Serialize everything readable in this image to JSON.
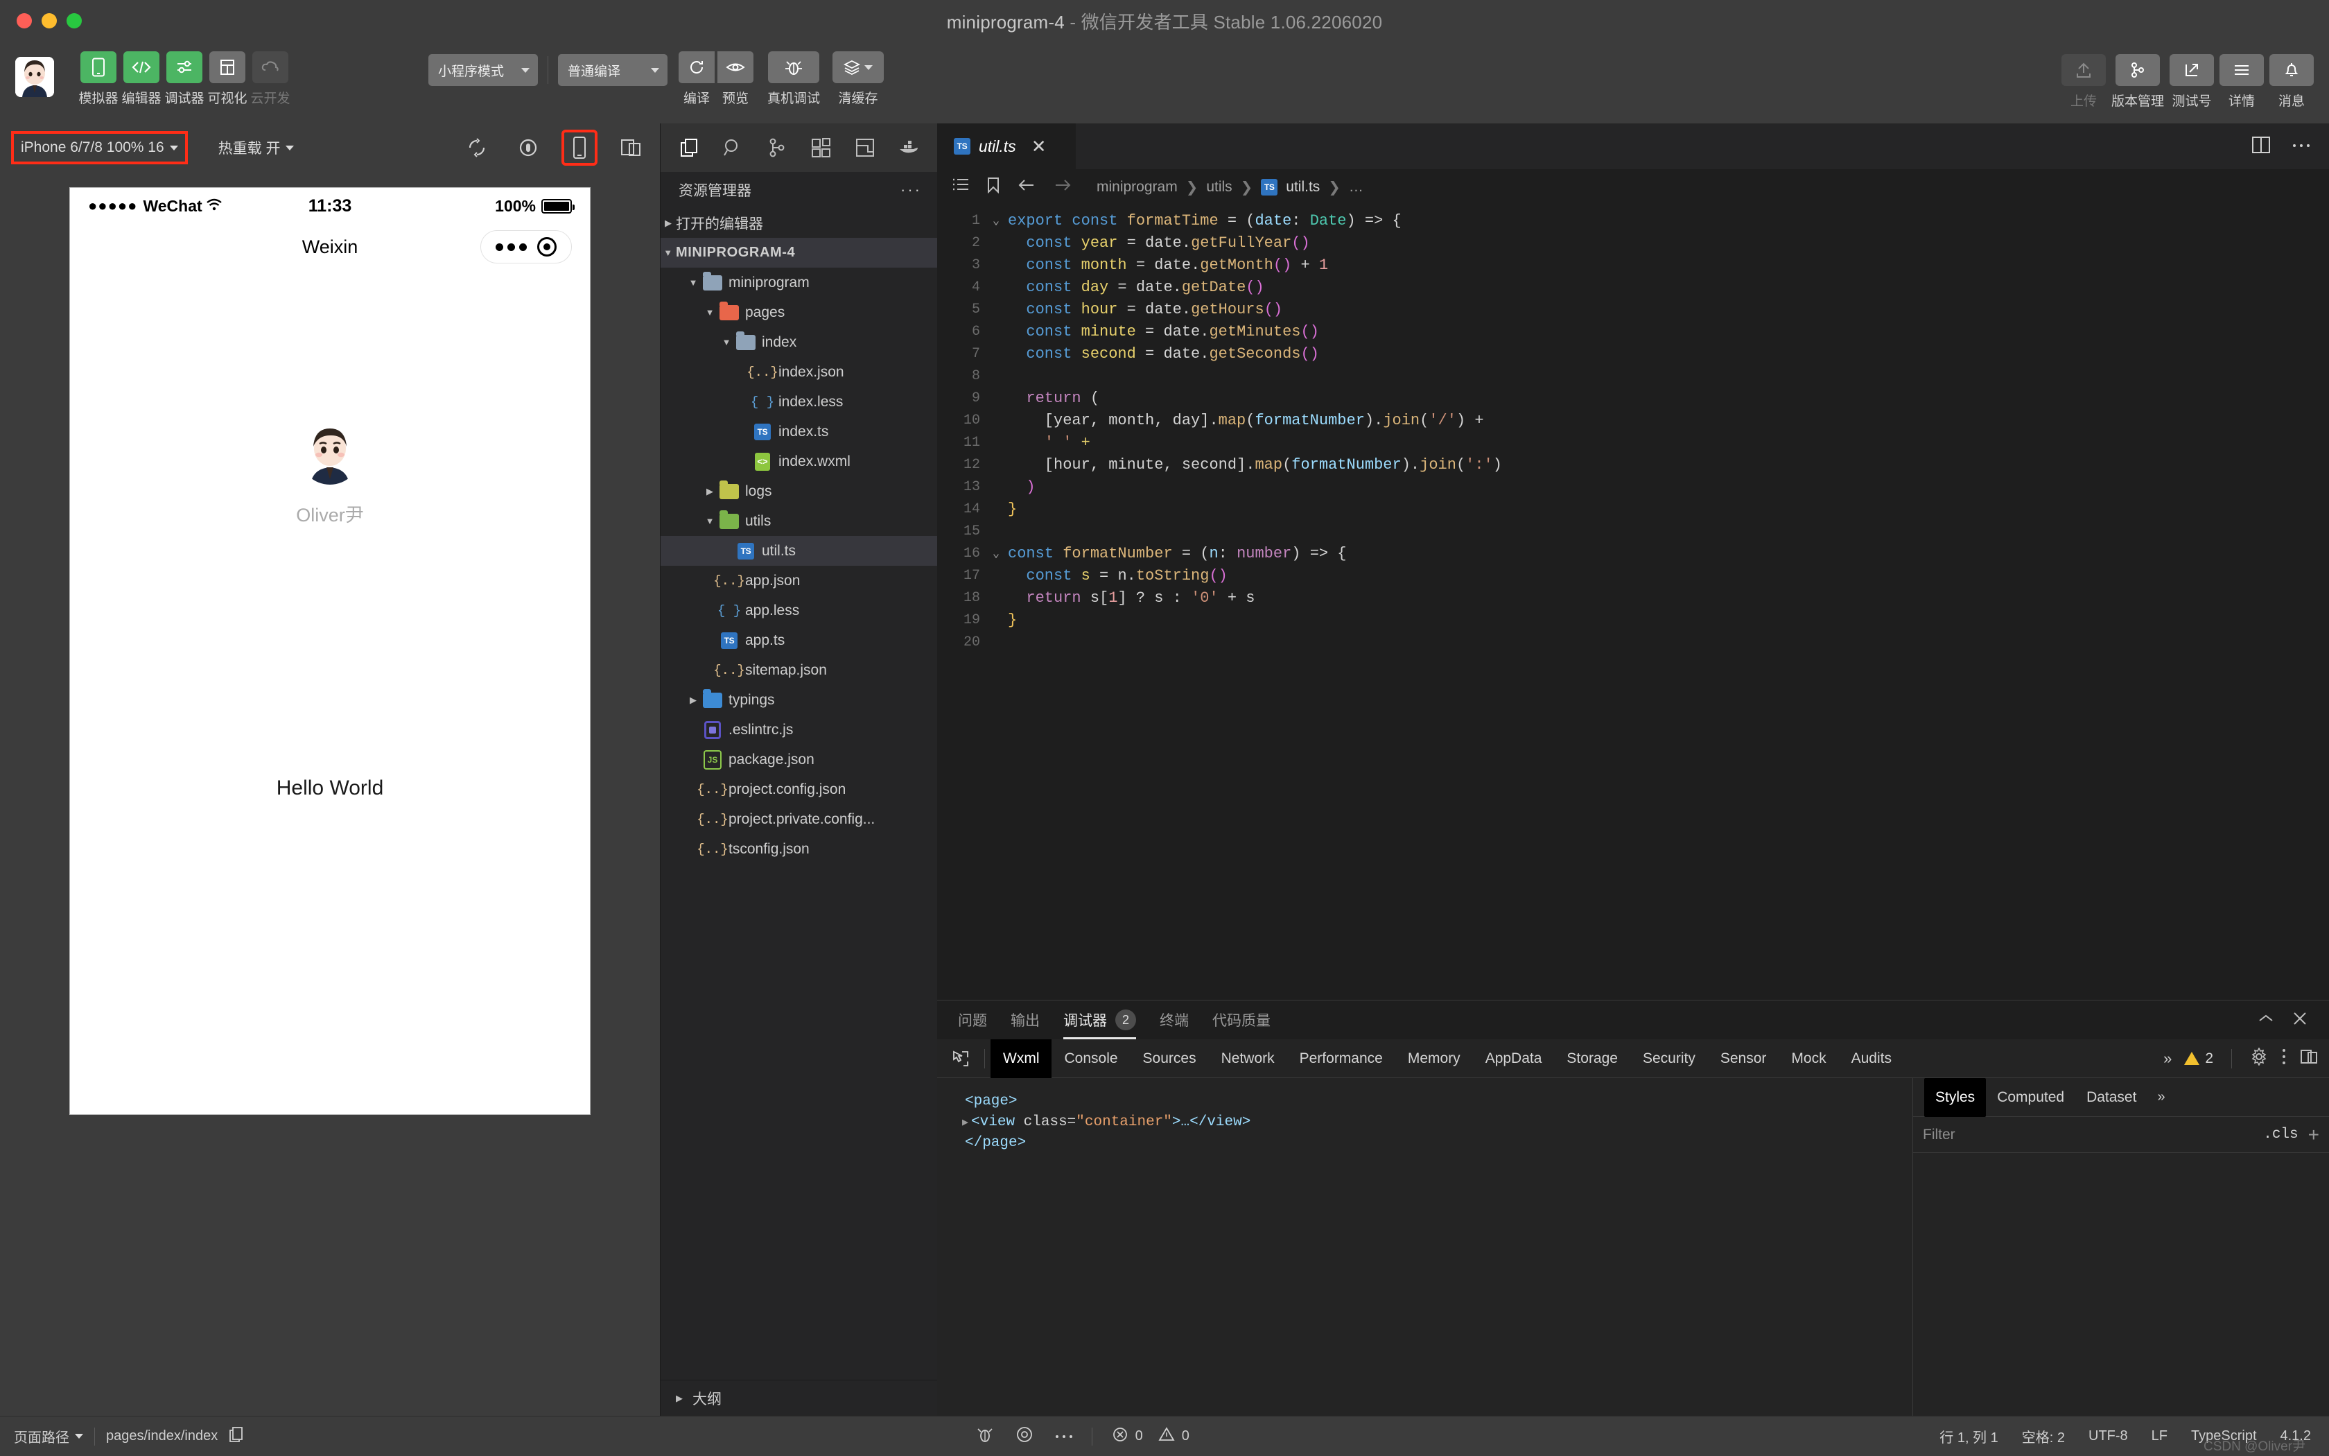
{
  "window": {
    "title": "miniprogram-4",
    "subtitle": " - 微信开发者工具 Stable 1.06.2206020"
  },
  "toolbar": {
    "modes": [
      {
        "name": "simulator",
        "label": "模拟器",
        "icon": "phone-icon",
        "active": true
      },
      {
        "name": "editor",
        "label": "编辑器",
        "icon": "code-icon",
        "active": true
      },
      {
        "name": "debugger",
        "label": "调试器",
        "icon": "sliders-icon",
        "active": true
      },
      {
        "name": "visual",
        "label": "可视化",
        "icon": "layout-icon",
        "active": false
      },
      {
        "name": "cloud",
        "label": "云开发",
        "icon": "cloud-icon",
        "active": false,
        "disabled": true
      }
    ],
    "project_mode": "小程序模式",
    "compile_mode": "普通编译",
    "actions": [
      {
        "name": "compile",
        "label": "编译",
        "icon": "refresh-icon"
      },
      {
        "name": "preview",
        "label": "预览",
        "icon": "eye-icon"
      },
      {
        "name": "remote-debug",
        "label": "真机调试",
        "icon": "bug-icon"
      },
      {
        "name": "clear-cache",
        "label": "清缓存",
        "icon": "layers-icon"
      }
    ],
    "right_actions": [
      {
        "name": "upload",
        "label": "上传",
        "icon": "upload-icon",
        "disabled": true
      },
      {
        "name": "version",
        "label": "版本管理",
        "icon": "branch-icon",
        "disabled": false
      },
      {
        "name": "test-account",
        "label": "测试号",
        "icon": "external-link-icon",
        "disabled": false
      },
      {
        "name": "details",
        "label": "详情",
        "icon": "menu-icon",
        "disabled": false
      },
      {
        "name": "messages",
        "label": "消息",
        "icon": "bell-icon",
        "disabled": false
      }
    ]
  },
  "simulator": {
    "device": "iPhone 6/7/8 100% 16",
    "hot_reload": "热重载 开",
    "highlight_color": "#ff2d17",
    "icons": [
      "rotate-icon",
      "record-icon",
      "phone-outline-icon",
      "split-window-icon"
    ],
    "phone": {
      "carrier": "WeChat",
      "signal_dots": "●●●●●",
      "time": "11:33",
      "battery_pct": "100%",
      "nav_title": "Weixin",
      "username": "Oliver尹",
      "body_text": "Hello World"
    }
  },
  "explorer": {
    "icon_bar": [
      "files-icon",
      "search-icon",
      "source-control-icon",
      "extensions-icon",
      "layout-panel-icon",
      "docker-icon"
    ],
    "title": "资源管理器",
    "more_label": "···",
    "open_editors_label": "打开的编辑器",
    "root_label": "MINIPROGRAM-4",
    "outline_label": "大纲",
    "tree": [
      {
        "label": "miniprogram",
        "type": "folder",
        "icon": "folder-icon",
        "depth": 1,
        "arrow": "down"
      },
      {
        "label": "pages",
        "type": "folder",
        "icon": "folder-pages-icon",
        "depth": 2,
        "arrow": "down"
      },
      {
        "label": "index",
        "type": "folder",
        "icon": "folder-icon",
        "depth": 3,
        "arrow": "down"
      },
      {
        "label": "index.json",
        "type": "json",
        "icon": "json-icon",
        "depth": 4,
        "arrow": ""
      },
      {
        "label": "index.less",
        "type": "less",
        "icon": "less-icon",
        "depth": 4,
        "arrow": ""
      },
      {
        "label": "index.ts",
        "type": "ts",
        "icon": "ts-icon",
        "depth": 4,
        "arrow": ""
      },
      {
        "label": "index.wxml",
        "type": "wxml",
        "icon": "wxml-icon",
        "depth": 4,
        "arrow": ""
      },
      {
        "label": "logs",
        "type": "folder",
        "icon": "folder-logs-icon",
        "depth": 2,
        "arrow": "right"
      },
      {
        "label": "utils",
        "type": "folder",
        "icon": "folder-utils-icon",
        "depth": 2,
        "arrow": "down"
      },
      {
        "label": "util.ts",
        "type": "ts",
        "icon": "ts-icon",
        "depth": 3,
        "arrow": "",
        "selected": true
      },
      {
        "label": "app.json",
        "type": "json",
        "icon": "json-icon",
        "depth": 2,
        "arrow": ""
      },
      {
        "label": "app.less",
        "type": "less",
        "icon": "less-icon",
        "depth": 2,
        "arrow": ""
      },
      {
        "label": "app.ts",
        "type": "ts",
        "icon": "ts-icon",
        "depth": 2,
        "arrow": ""
      },
      {
        "label": "sitemap.json",
        "type": "json",
        "icon": "json-icon",
        "depth": 2,
        "arrow": ""
      },
      {
        "label": "typings",
        "type": "folder",
        "icon": "folder-typings-icon",
        "depth": 1,
        "arrow": "right"
      },
      {
        "label": ".eslintrc.js",
        "type": "eslint",
        "icon": "eslint-icon",
        "depth": 1,
        "arrow": ""
      },
      {
        "label": "package.json",
        "type": "node",
        "icon": "node-icon",
        "depth": 1,
        "arrow": ""
      },
      {
        "label": "project.config.json",
        "type": "json",
        "icon": "json-icon",
        "depth": 1,
        "arrow": ""
      },
      {
        "label": "project.private.config...",
        "type": "json",
        "icon": "json-icon",
        "depth": 1,
        "arrow": ""
      },
      {
        "label": "tsconfig.json",
        "type": "json",
        "icon": "json-icon",
        "depth": 1,
        "arrow": ""
      }
    ]
  },
  "editor": {
    "tab": {
      "label": "util.ts",
      "icon": "ts-icon",
      "close": "✕"
    },
    "tab_right_icons": [
      "split-editor-icon",
      "more-icon"
    ],
    "breadcrumb_icons": [
      "outline-icon",
      "bookmark-icon",
      "back-arrow-icon",
      "forward-arrow-icon"
    ],
    "breadcrumb": [
      "miniprogram",
      "utils",
      "util.ts",
      "…"
    ],
    "lines": [
      {
        "n": 1,
        "fold": "⌄",
        "tokens": [
          [
            "k-kw",
            "export "
          ],
          [
            "k-kw",
            "const "
          ],
          [
            "k-fn",
            "formatTime"
          ],
          [
            "k-op",
            " = "
          ],
          [
            "k-op",
            "("
          ],
          [
            "k-var",
            "date"
          ],
          [
            "k-op",
            ": "
          ],
          [
            "k-type",
            "Date"
          ],
          [
            "k-op",
            ") => {"
          ]
        ]
      },
      {
        "n": 2,
        "fold": "",
        "tokens": [
          [
            "k-op",
            "  "
          ],
          [
            "k-kw",
            "const "
          ],
          [
            "k-decl",
            "year"
          ],
          [
            "k-op",
            " = "
          ],
          [
            "k-plain",
            "date"
          ],
          [
            "k-op",
            "."
          ],
          [
            "k-method",
            "getFullYear"
          ],
          [
            "k-par",
            "()"
          ]
        ]
      },
      {
        "n": 3,
        "fold": "",
        "tokens": [
          [
            "k-op",
            "  "
          ],
          [
            "k-kw",
            "const "
          ],
          [
            "k-decl",
            "month"
          ],
          [
            "k-op",
            " = "
          ],
          [
            "k-plain",
            "date"
          ],
          [
            "k-op",
            "."
          ],
          [
            "k-method",
            "getMonth"
          ],
          [
            "k-par",
            "()"
          ],
          [
            "k-op",
            " + "
          ],
          [
            "k-num",
            "1"
          ]
        ]
      },
      {
        "n": 4,
        "fold": "",
        "tokens": [
          [
            "k-op",
            "  "
          ],
          [
            "k-kw",
            "const "
          ],
          [
            "k-decl",
            "day"
          ],
          [
            "k-op",
            " = "
          ],
          [
            "k-plain",
            "date"
          ],
          [
            "k-op",
            "."
          ],
          [
            "k-method",
            "getDate"
          ],
          [
            "k-par",
            "()"
          ]
        ]
      },
      {
        "n": 5,
        "fold": "",
        "tokens": [
          [
            "k-op",
            "  "
          ],
          [
            "k-kw",
            "const "
          ],
          [
            "k-decl",
            "hour"
          ],
          [
            "k-op",
            " = "
          ],
          [
            "k-plain",
            "date"
          ],
          [
            "k-op",
            "."
          ],
          [
            "k-method",
            "getHours"
          ],
          [
            "k-par",
            "()"
          ]
        ]
      },
      {
        "n": 6,
        "fold": "",
        "tokens": [
          [
            "k-op",
            "  "
          ],
          [
            "k-kw",
            "const "
          ],
          [
            "k-decl",
            "minute"
          ],
          [
            "k-op",
            " = "
          ],
          [
            "k-plain",
            "date"
          ],
          [
            "k-op",
            "."
          ],
          [
            "k-method",
            "getMinutes"
          ],
          [
            "k-par",
            "()"
          ]
        ]
      },
      {
        "n": 7,
        "fold": "",
        "tokens": [
          [
            "k-op",
            "  "
          ],
          [
            "k-kw",
            "const "
          ],
          [
            "k-decl",
            "second"
          ],
          [
            "k-op",
            " = "
          ],
          [
            "k-plain",
            "date"
          ],
          [
            "k-op",
            "."
          ],
          [
            "k-method",
            "getSeconds"
          ],
          [
            "k-par",
            "()"
          ]
        ]
      },
      {
        "n": 8,
        "fold": "",
        "tokens": []
      },
      {
        "n": 9,
        "fold": "",
        "tokens": [
          [
            "k-op",
            "  "
          ],
          [
            "k-ctl",
            "return "
          ],
          [
            "k-op",
            "("
          ]
        ]
      },
      {
        "n": 10,
        "fold": "",
        "tokens": [
          [
            "k-op",
            "    ["
          ],
          [
            "k-plain",
            "year, month, day"
          ],
          [
            "k-op",
            "]."
          ],
          [
            "k-method",
            "map"
          ],
          [
            "k-op",
            "("
          ],
          [
            "k-var",
            "formatNumber"
          ],
          [
            "k-op",
            ")."
          ],
          [
            "k-method",
            "join"
          ],
          [
            "k-op",
            "("
          ],
          [
            "k-str",
            "'/'"
          ],
          [
            "k-op",
            ") + "
          ]
        ]
      },
      {
        "n": 11,
        "fold": "",
        "tokens": [
          [
            "k-op",
            "    "
          ],
          [
            "k-str",
            "' '"
          ],
          [
            "k-decl",
            " +"
          ]
        ]
      },
      {
        "n": 12,
        "fold": "",
        "tokens": [
          [
            "k-op",
            "    ["
          ],
          [
            "k-plain",
            "hour, minute, second"
          ],
          [
            "k-op",
            "]."
          ],
          [
            "k-method",
            "map"
          ],
          [
            "k-op",
            "("
          ],
          [
            "k-var",
            "formatNumber"
          ],
          [
            "k-op",
            ")."
          ],
          [
            "k-method",
            "join"
          ],
          [
            "k-op",
            "("
          ],
          [
            "k-str",
            "':'"
          ],
          [
            "k-op",
            ")"
          ]
        ]
      },
      {
        "n": 13,
        "fold": "",
        "tokens": [
          [
            "k-op",
            "  "
          ],
          [
            "k-par",
            ")"
          ]
        ]
      },
      {
        "n": 14,
        "fold": "",
        "tokens": [
          [
            "k-cls",
            "}"
          ]
        ]
      },
      {
        "n": 15,
        "fold": "",
        "tokens": []
      },
      {
        "n": 16,
        "fold": "⌄",
        "tokens": [
          [
            "k-kw",
            "const "
          ],
          [
            "k-fn",
            "formatNumber"
          ],
          [
            "k-op",
            " = "
          ],
          [
            "k-op",
            "("
          ],
          [
            "k-var",
            "n"
          ],
          [
            "k-op",
            ": "
          ],
          [
            "k-purple",
            "number"
          ],
          [
            "k-op",
            ") => {"
          ]
        ]
      },
      {
        "n": 17,
        "fold": "",
        "tokens": [
          [
            "k-op",
            "  "
          ],
          [
            "k-kw",
            "const "
          ],
          [
            "k-decl",
            "s"
          ],
          [
            "k-op",
            " = "
          ],
          [
            "k-plain",
            "n"
          ],
          [
            "k-op",
            "."
          ],
          [
            "k-method",
            "toString"
          ],
          [
            "k-par",
            "()"
          ]
        ]
      },
      {
        "n": 18,
        "fold": "",
        "tokens": [
          [
            "k-op",
            "  "
          ],
          [
            "k-ctl",
            "return "
          ],
          [
            "k-plain",
            "s"
          ],
          [
            "k-op",
            "["
          ],
          [
            "k-num",
            "1"
          ],
          [
            "k-op",
            "] ? "
          ],
          [
            "k-plain",
            "s"
          ],
          [
            "k-op",
            " : "
          ],
          [
            "k-str",
            "'0'"
          ],
          [
            "k-op",
            " + "
          ],
          [
            "k-plain",
            "s"
          ]
        ]
      },
      {
        "n": 19,
        "fold": "",
        "tokens": [
          [
            "k-cls",
            "}"
          ]
        ]
      },
      {
        "n": 20,
        "fold": "",
        "tokens": []
      }
    ]
  },
  "debugger": {
    "panel_tabs": [
      {
        "label": "问题",
        "active": false,
        "badge": ""
      },
      {
        "label": "输出",
        "active": false,
        "badge": ""
      },
      {
        "label": "调试器",
        "active": true,
        "badge": "2"
      },
      {
        "label": "终端",
        "active": false,
        "badge": ""
      },
      {
        "label": "代码质量",
        "active": false,
        "badge": ""
      }
    ],
    "panel_right_icons": [
      "chevron-up-icon",
      "close-icon"
    ],
    "devtools_tabs": [
      {
        "label": "Wxml",
        "active": true
      },
      {
        "label": "Console",
        "active": false
      },
      {
        "label": "Sources",
        "active": false
      },
      {
        "label": "Network",
        "active": false
      },
      {
        "label": "Performance",
        "active": false
      },
      {
        "label": "Memory",
        "active": false
      },
      {
        "label": "AppData",
        "active": false
      },
      {
        "label": "Storage",
        "active": false
      },
      {
        "label": "Security",
        "active": false
      },
      {
        "label": "Sensor",
        "active": false
      },
      {
        "label": "Mock",
        "active": false
      },
      {
        "label": "Audits",
        "active": false
      }
    ],
    "overflow_label": "»",
    "warning_count": "2",
    "devtools_right_icons": [
      "gear-icon",
      "kebab-icon",
      "dock-icon"
    ],
    "wxml": [
      {
        "indent": 0,
        "arrow": "",
        "tokens": [
          [
            "wx-tag",
            "<page>"
          ]
        ]
      },
      {
        "indent": 1,
        "arrow": "▶",
        "tokens": [
          [
            "wx-tag",
            "<view "
          ],
          [
            "wx-attr",
            "class="
          ],
          [
            "wx-val",
            "\"container\""
          ],
          [
            "wx-tag",
            ">…</view>"
          ]
        ]
      },
      {
        "indent": 0,
        "arrow": "",
        "tokens": [
          [
            "wx-tag",
            "</page>"
          ]
        ]
      }
    ],
    "styles_tabs": [
      {
        "label": "Styles",
        "active": true
      },
      {
        "label": "Computed",
        "active": false
      },
      {
        "label": "Dataset",
        "active": false
      }
    ],
    "styles_more": "»",
    "filter_placeholder": "Filter",
    "cls_label": ".cls",
    "plus_label": "+"
  },
  "statusbar": {
    "page_path_label": "页面路径",
    "page_path_value": "pages/index/index",
    "copy_icon": "copy-icon",
    "left_icons": [
      "bug-icon",
      "record-circle-icon",
      "ellipsis-icon"
    ],
    "error_count": "0",
    "warning_count": "0",
    "line_col": "行 1, 列 1",
    "spaces": "空格: 2",
    "encoding": "UTF-8",
    "eol": "LF",
    "language": "TypeScript",
    "version": "4.1.2",
    "watermark": "CSDN @Oliver尹"
  }
}
